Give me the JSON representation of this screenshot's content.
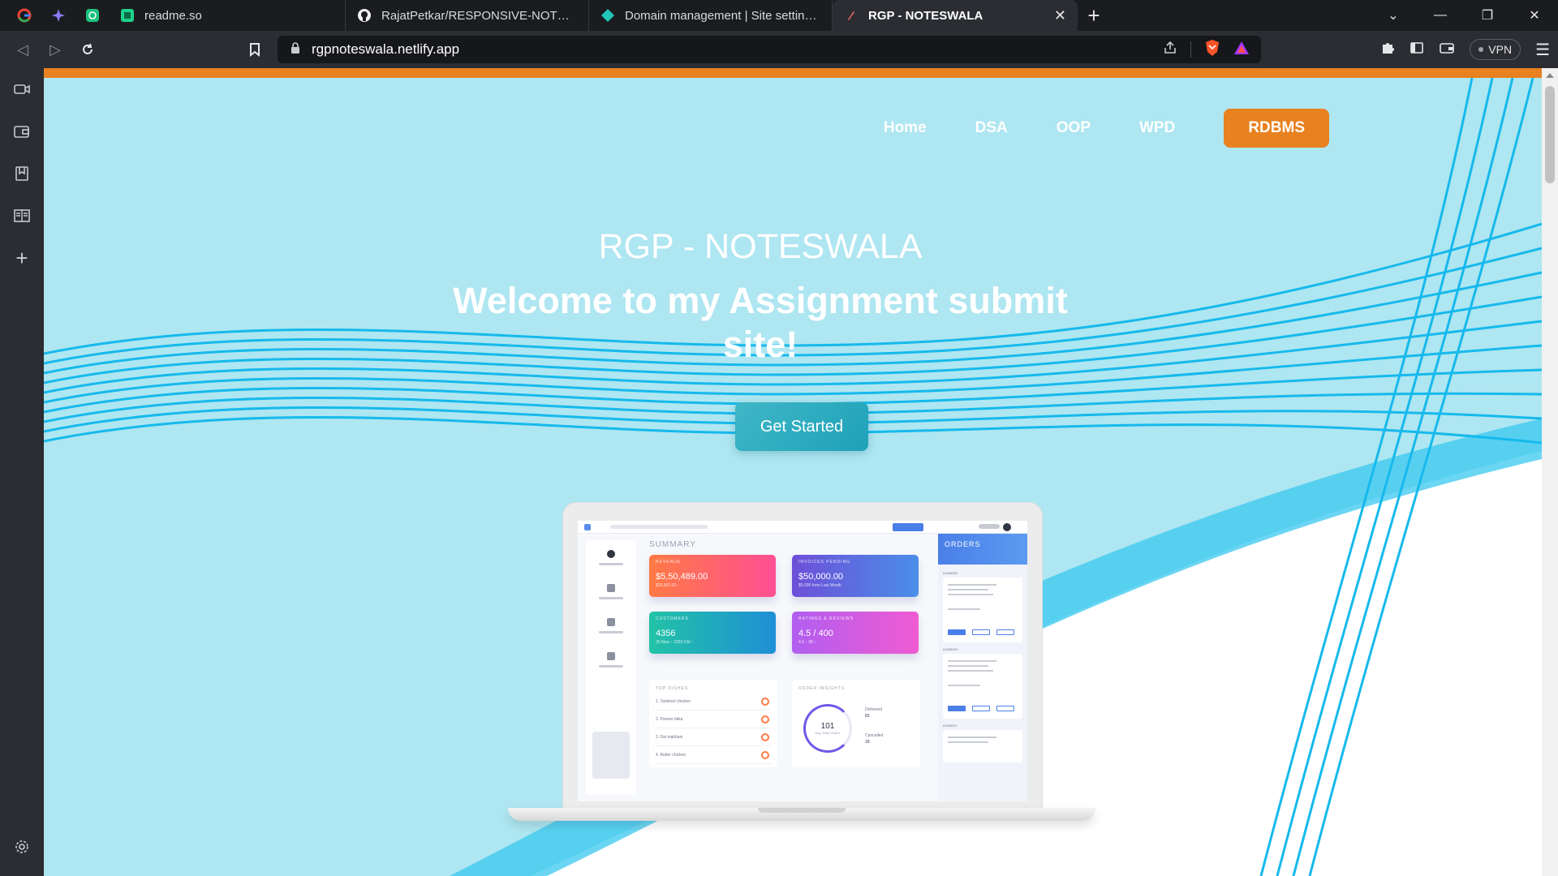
{
  "browser": {
    "pinned_tabs": [
      "google-icon",
      "sparkle-icon",
      "chatgpt-icon"
    ],
    "tabs": [
      {
        "title": "readme.so",
        "icon": "readme-icon",
        "active": false
      },
      {
        "title": "RajatPetkar/RESPONSIVE-NOTES-WEB",
        "icon": "github-icon",
        "active": false
      },
      {
        "title": "Domain management | Site settings | r",
        "icon": "netlify-icon",
        "active": false
      },
      {
        "title": "RGP - NOTESWALA",
        "icon": "site-icon",
        "active": true
      }
    ],
    "url": "rgpnoteswala.netlify.app",
    "vpn_label": "VPN",
    "accent": "#e8811f"
  },
  "site": {
    "nav": [
      "Home",
      "DSA",
      "OOP",
      "WPD"
    ],
    "nav_cta": "RDBMS",
    "title": "RGP - NOTESWALA",
    "subtitle": "Welcome to my Assignment submit site!",
    "button": "Get Started",
    "colors": {
      "background": "#aee6f1",
      "wave": "#16b9ec",
      "cta_orange": "#e8811f",
      "button_teal": "#2aaabd"
    },
    "mockup": {
      "summary": "SUMMARY",
      "cards": [
        {
          "caption": "REVENUE",
          "value": "$5,50,489.00",
          "sub": "$25,562.00 ↑"
        },
        {
          "caption": "INVOICES PENDING",
          "value": "$50,000.00",
          "sub": "$5,000 from Last Month"
        },
        {
          "caption": "CUSTOMERS",
          "value": "4356",
          "sub": "25 New ↑   3260 Old ↑"
        },
        {
          "caption": "RATINGS & REVIEWS",
          "value": "4.5 / 400",
          "sub": "4.6 ↑   38 ↑"
        }
      ],
      "top_dishes": "TOP DISHES",
      "dishes": [
        "1. Tandoori chicken",
        "2. Paneer tikka",
        "3. Dal makhani",
        "4. Butter chicken"
      ],
      "order_insights": "ORDER INSIGHTS",
      "ring_value": "101",
      "ring_label": "Avg. Daily Orders",
      "delivered_label": "Delivered",
      "delivered_value": "83",
      "cancelled_label": "Cancelled",
      "cancelled_value": "18",
      "orders_title": "ORDERS",
      "order_ids": [
        "#1056250",
        "#1056249",
        "#1056247"
      ]
    }
  }
}
